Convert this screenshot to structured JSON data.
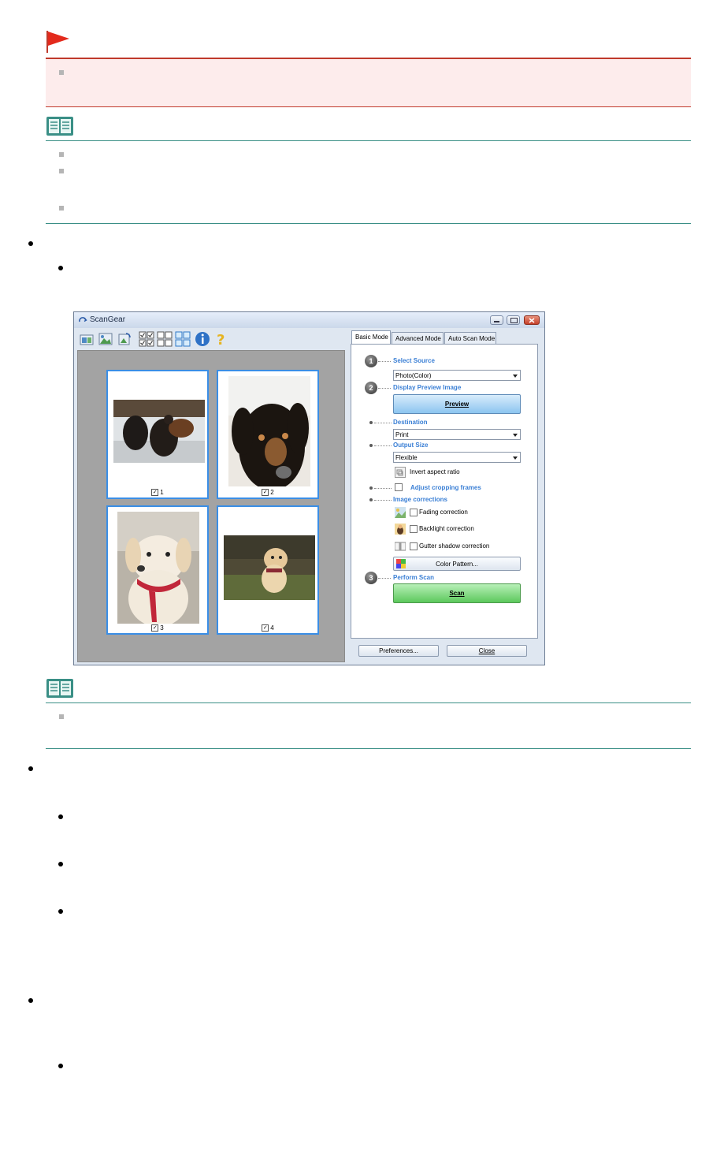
{
  "window": {
    "title": "ScanGear",
    "tabs": [
      "Basic Mode",
      "Advanced Mode",
      "Auto Scan Mode"
    ],
    "thumbnails": [
      {
        "label": "1",
        "checked": true
      },
      {
        "label": "2",
        "checked": true
      },
      {
        "label": "3",
        "checked": true
      },
      {
        "label": "4",
        "checked": true
      }
    ],
    "steps": {
      "step1": "1",
      "step2": "2",
      "step3": "3"
    },
    "select_source": {
      "heading": "Select Source",
      "value": "Photo(Color)"
    },
    "display_preview": {
      "heading": "Display Preview Image",
      "button": "Preview"
    },
    "destination": {
      "heading": "Destination",
      "value": "Print"
    },
    "output_size": {
      "heading": "Output Size",
      "value": "Flexible",
      "invert_label": "Invert aspect ratio"
    },
    "adjust_cropping": "Adjust cropping frames",
    "image_corrections": {
      "heading": "Image corrections",
      "fading": "Fading correction",
      "backlight": "Backlight correction",
      "gutter": "Gutter shadow correction",
      "color_pattern": "Color Pattern..."
    },
    "perform_scan": {
      "heading": "Perform Scan",
      "button": "Scan"
    },
    "preferences_button": "Preferences...",
    "close_button": "Close"
  },
  "colors": {
    "important_red": "#c0392b",
    "note_teal": "#3a8f86",
    "link_blue": "#3a7fd5",
    "frame_blue": "#3a8ee6"
  }
}
